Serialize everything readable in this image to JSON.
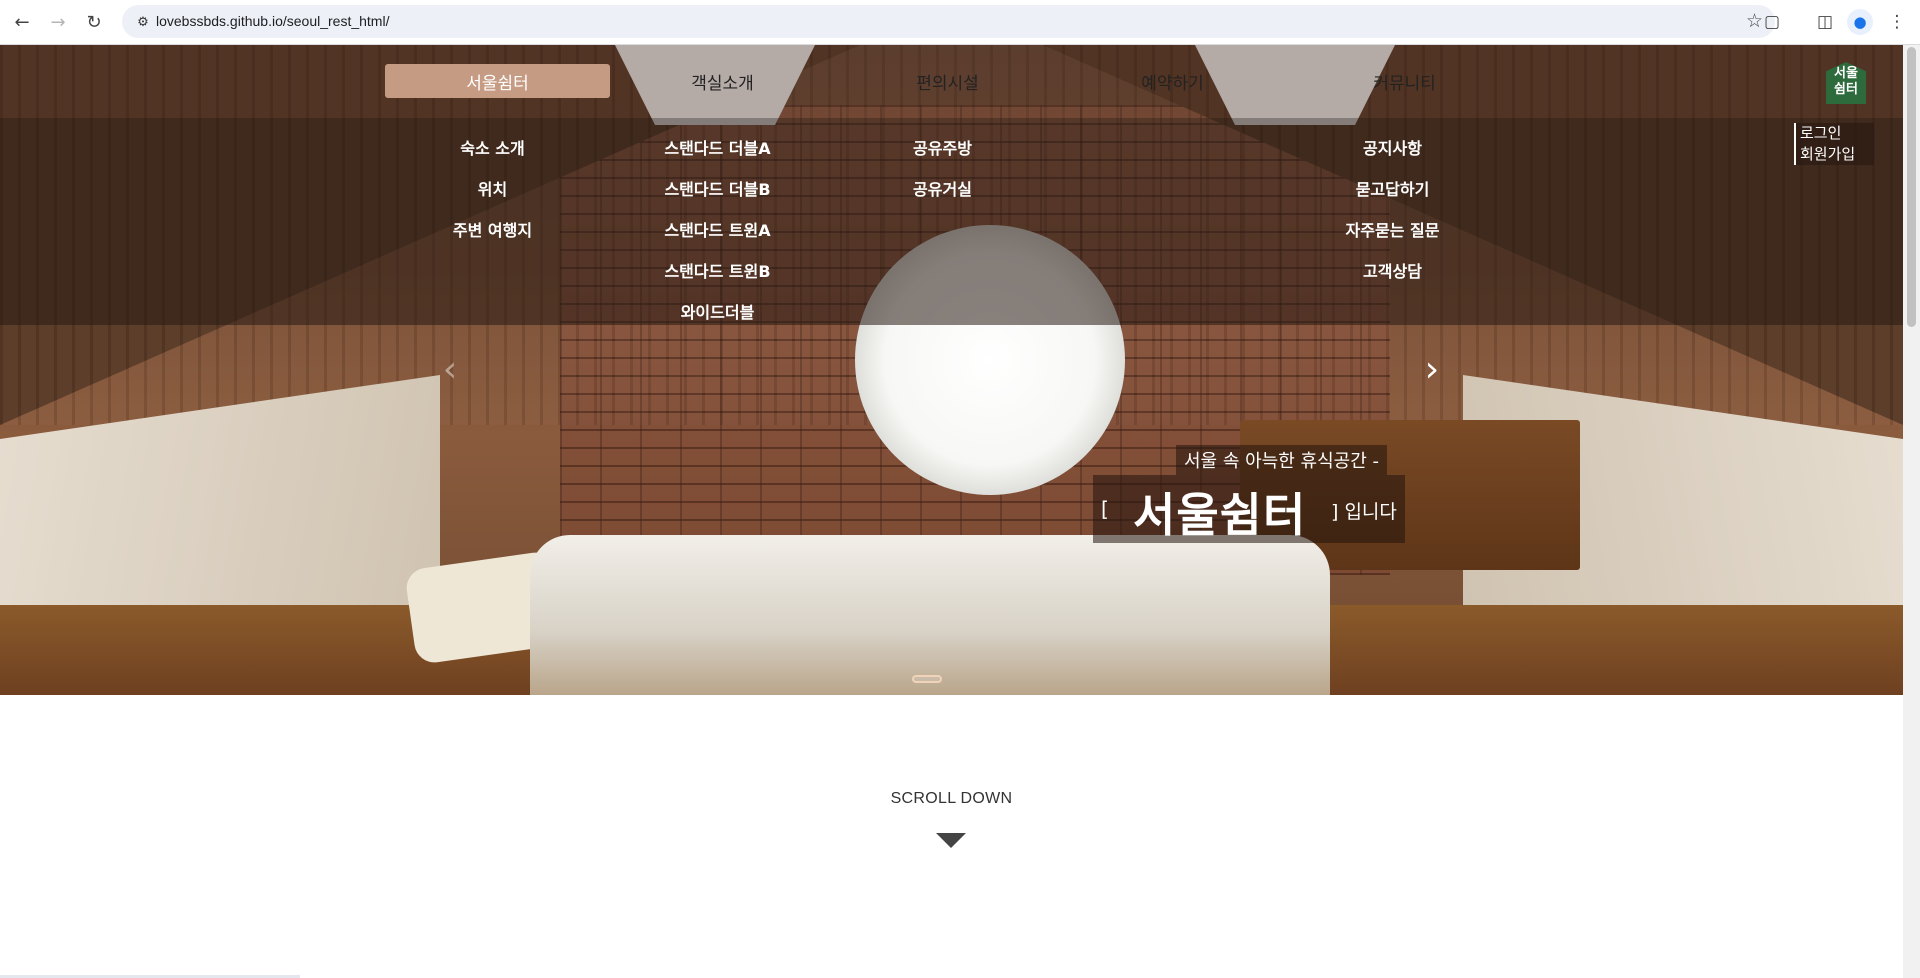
{
  "browser": {
    "url": "lovebssbds.github.io/seoul_rest_html/",
    "back_icon": "arrow-left",
    "forward_icon": "arrow-right",
    "reload_icon": "reload",
    "site_info_icon": "tune",
    "bookmark_icon": "star-outline",
    "extensions_icon": "puzzle",
    "sidepanel_icon": "side-panel",
    "profile_icon": "person",
    "menu_icon": "kebab"
  },
  "nav": {
    "items": [
      {
        "label": "서울쉼터"
      },
      {
        "label": "객실소개"
      },
      {
        "label": "편의시설"
      },
      {
        "label": "예약하기"
      },
      {
        "label": "커뮤니티"
      }
    ],
    "active_color": "#c59b84"
  },
  "logo": {
    "line1": "서울",
    "line2": "쉼터",
    "color": "#2e6b3c"
  },
  "member": {
    "login": "로그인",
    "join": "회원가입"
  },
  "submenu": {
    "col1": [
      "숙소 소개",
      "위치",
      "주변 여행지"
    ],
    "col2": [
      "스탠다드 더블A",
      "스탠다드 더블B",
      "스탠다드 트윈A",
      "스탠다드 트윈B",
      "와이드더블"
    ],
    "col3": [
      "공유주방",
      "공유거실"
    ],
    "col4": [],
    "col5": [
      "공지사항",
      "묻고답하기",
      "자주묻는 질문",
      "고객상담"
    ]
  },
  "hero": {
    "tagline": "서울 속 아늑한 휴식공간 -",
    "bracket_open": "[",
    "title": "서울쉼터",
    "bracket_close": "] 입니다",
    "prev_icon": "chevron-left",
    "next_icon": "chevron-right"
  },
  "scroll": {
    "label": "SCROLL DOWN",
    "icon": "triangle-down"
  }
}
